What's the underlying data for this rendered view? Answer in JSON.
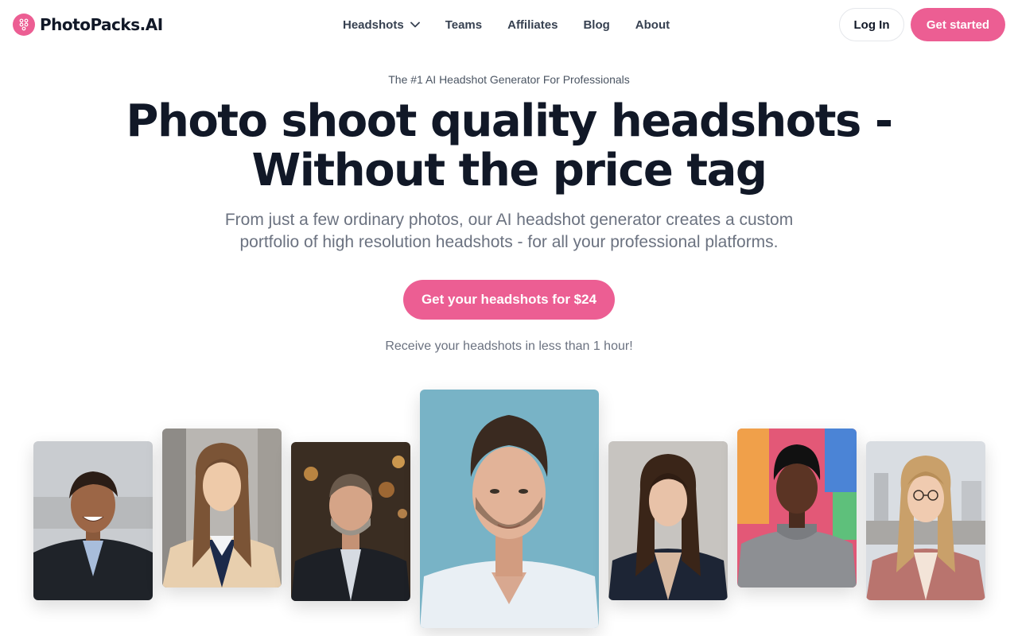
{
  "brand": {
    "name": "PhotoPacks.AI",
    "logo_icon": "dots-grid-icon",
    "accent": "#ec5e93"
  },
  "nav": {
    "items": [
      {
        "label": "Headshots",
        "has_dropdown": true
      },
      {
        "label": "Teams"
      },
      {
        "label": "Affiliates"
      },
      {
        "label": "Blog"
      },
      {
        "label": "About"
      }
    ],
    "login_label": "Log In",
    "start_label": "Get started"
  },
  "hero": {
    "eyebrow": "The #1 AI Headshot Generator For Professionals",
    "headline_line1": "Photo shoot quality headshots -",
    "headline_line2": "Without the price tag",
    "subhead_line1": "From just a few ordinary photos, our AI headshot generator creates a custom",
    "subhead_line2": "portfolio of high resolution headshots - for all your professional platforms.",
    "cta_label": "Get your headshots for $24",
    "note": "Receive your headshots in less than 1 hour!"
  },
  "gallery": {
    "photos": [
      {
        "name": "smiling-man-suit"
      },
      {
        "name": "woman-long-hair-blazer"
      },
      {
        "name": "older-man-beard"
      },
      {
        "name": "man-stubble-blue-bg"
      },
      {
        "name": "woman-dark-hair"
      },
      {
        "name": "man-gray-hoodie"
      },
      {
        "name": "woman-glasses-pink-blazer"
      }
    ]
  }
}
